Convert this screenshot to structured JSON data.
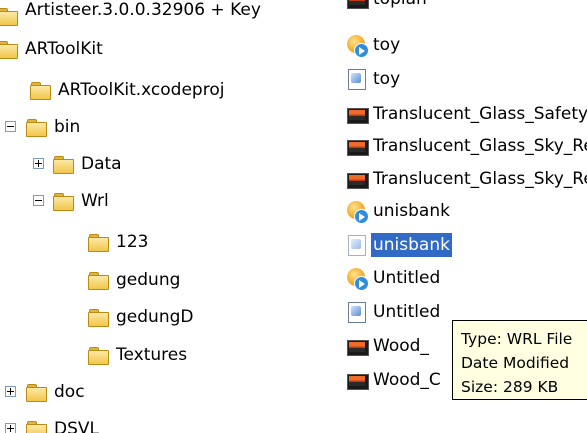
{
  "folder_tree": {
    "items": [
      {
        "label": "Artisteer.3.0.0.32906 + Key",
        "expander": ""
      },
      {
        "label": "ARToolKit",
        "expander": ""
      },
      {
        "label": "ARToolKit.xcodeproj",
        "expander": ""
      },
      {
        "label": "bin",
        "expander": "minus"
      },
      {
        "label": "Data",
        "expander": "plus"
      },
      {
        "label": "Wrl",
        "expander": "minus"
      },
      {
        "label": "123",
        "expander": ""
      },
      {
        "label": "gedung",
        "expander": ""
      },
      {
        "label": "gedungD",
        "expander": ""
      },
      {
        "label": "Textures",
        "expander": ""
      },
      {
        "label": "doc",
        "expander": "plus"
      },
      {
        "label": "DSVL",
        "expander": "plus"
      }
    ]
  },
  "file_list": {
    "items": [
      {
        "label": "toplan",
        "icon": "image-file-icon",
        "selected": false
      },
      {
        "label": "toy",
        "icon": "media-globe-icon",
        "selected": false
      },
      {
        "label": "toy",
        "icon": "vrml-document-icon",
        "selected": false
      },
      {
        "label": "Translucent_Glass_Safety",
        "icon": "image-file-icon",
        "selected": false
      },
      {
        "label": "Translucent_Glass_Sky_Reflection",
        "icon": "image-file-icon",
        "selected": false
      },
      {
        "label": "Translucent_Glass_Sky_Reflection",
        "icon": "image-file-icon",
        "selected": false
      },
      {
        "label": "unisbank",
        "icon": "media-globe-icon",
        "selected": false
      },
      {
        "label": "unisbank",
        "icon": "vrml-document-icon",
        "selected": true
      },
      {
        "label": "Untitled",
        "icon": "media-globe-icon",
        "selected": false
      },
      {
        "label": "Untitled",
        "icon": "vrml-document-icon",
        "selected": false
      },
      {
        "label": "Wood_",
        "icon": "image-file-icon",
        "selected": false
      },
      {
        "label": "Wood_C",
        "icon": "image-file-icon",
        "selected": false
      }
    ]
  },
  "tooltip": {
    "type": "Type: WRL File",
    "date_modified": "Date Modified",
    "size": "Size: 289 KB"
  },
  "colors": {
    "selection": "#316ac5",
    "tooltip_bg": "#ffffe1",
    "expander_border": "#7f9db9"
  }
}
